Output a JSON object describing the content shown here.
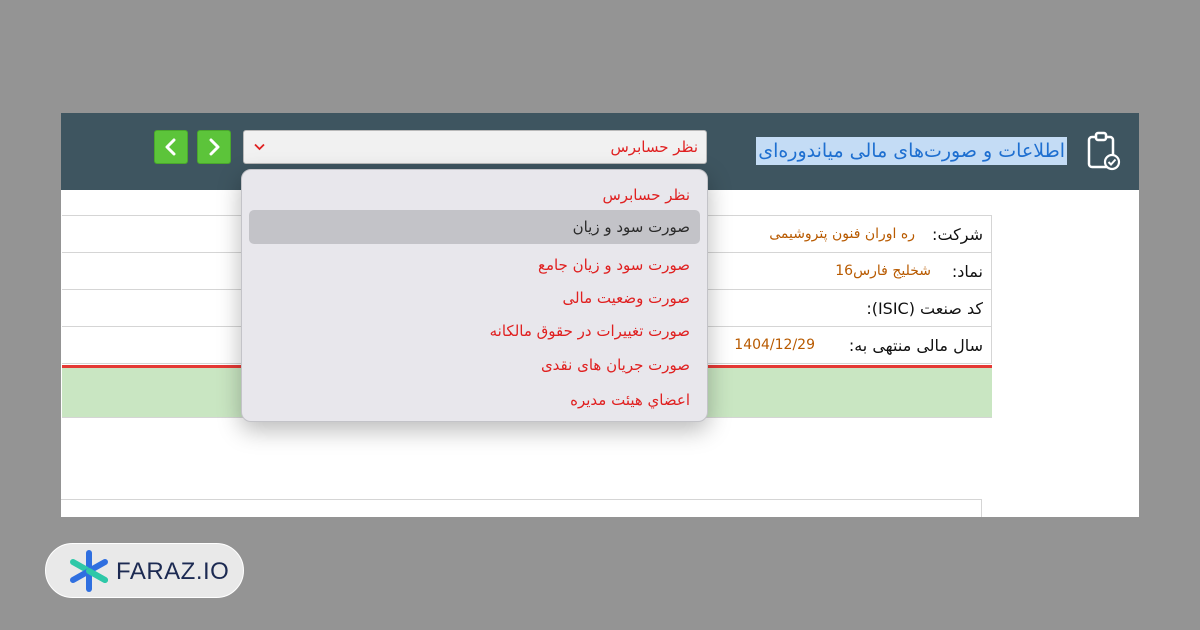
{
  "header": {
    "title": "اطلاعات و صورت‌های مالی میاندوره‌ای",
    "statement_select": {
      "selected": "نظر حسابرس"
    },
    "colors": {
      "bar": "#3e5560",
      "nav_button": "#5cc43a",
      "title_link": "#1e6fd0"
    },
    "icons": [
      "clipboard-check-icon",
      "chevron-down-icon",
      "chevron-left-icon",
      "chevron-right-icon"
    ]
  },
  "dropdown": {
    "items": [
      {
        "label": "نظر حسابرس",
        "color": "#e02020",
        "highlighted": false
      },
      {
        "label": "صورت سود و زیان",
        "color": "#2b2b2b",
        "highlighted": true
      },
      {
        "label": "صورت سود و زیان جامع",
        "color": "#e02020",
        "highlighted": false
      },
      {
        "label": "صورت وضعیت مالی",
        "color": "#e02020",
        "highlighted": false
      },
      {
        "label": "صورت تغییرات در حقوق مالکانه",
        "color": "#e02020",
        "highlighted": false
      },
      {
        "label": "صورت جریان های نقدی",
        "color": "#e02020",
        "highlighted": false
      },
      {
        "label": "اعضاي هيئت مديره",
        "color": "#e02020",
        "highlighted": false
      }
    ]
  },
  "company_info": {
    "company_label": "شرکت:",
    "company_value": "ره اوران فنون پتروشیمی",
    "symbol_label": "نماد:",
    "symbol_value": "شخلیج فارس16",
    "isic_label": "کد صنعت (ISIC):",
    "fiscal_year_label": "سال مالی منتهی به:",
    "fiscal_year_value": "1404/12/29"
  },
  "branding": {
    "logo_text": "FARAZ.IO",
    "colors": {
      "mark_blue": "#2f6fe0",
      "mark_teal": "#2ec8a8",
      "text": "#1c2a52"
    }
  }
}
